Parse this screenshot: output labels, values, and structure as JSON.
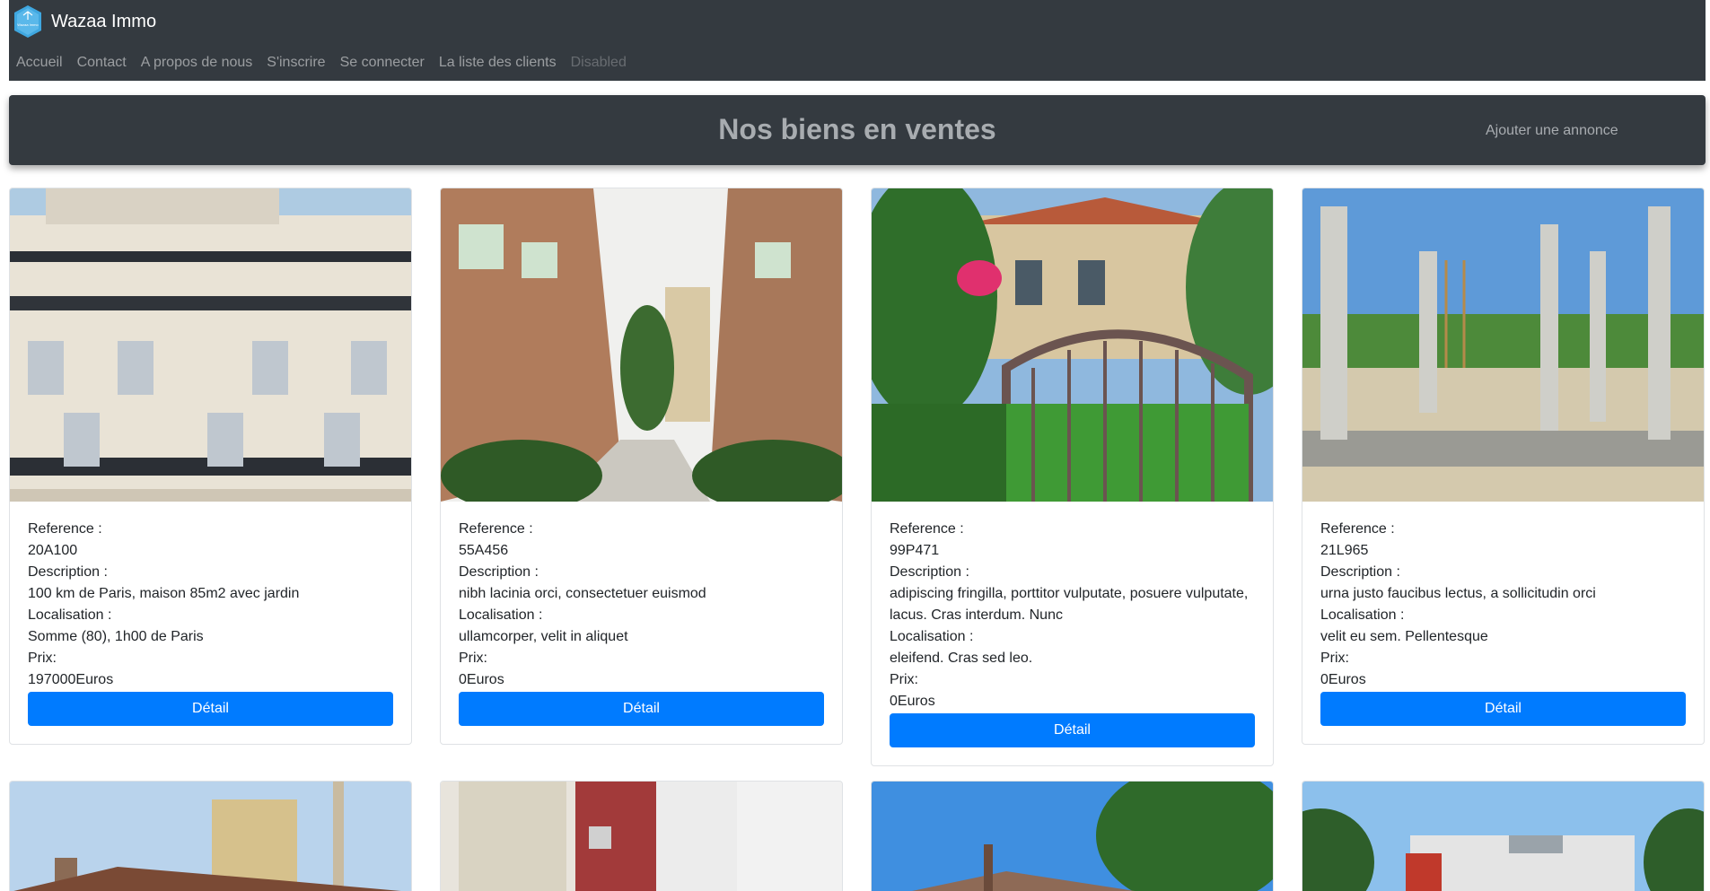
{
  "navbar": {
    "brand": "Wazaa Immo",
    "logo_text": "Wazaa Immo",
    "links": [
      "Accueil",
      "Contact",
      "A propos de nous",
      "S'inscrire",
      "Se connecter",
      "La liste des clients"
    ],
    "disabled_link": "Disabled"
  },
  "banner": {
    "title": "Nos biens en ventes",
    "add_link": "Ajouter une annonce"
  },
  "cards": [
    {
      "ref_label": "Reference :",
      "ref": "20A100",
      "desc_label": "Description :",
      "desc": "100 km de Paris, maison 85m2 avec jardin",
      "loc_label": "Localisation :",
      "loc": "Somme (80), 1h00 de Paris",
      "price_label": "Prix:",
      "price": "197000Euros",
      "button": "Détail"
    },
    {
      "ref_label": "Reference :",
      "ref": "55A456",
      "desc_label": "Description :",
      "desc": "nibh lacinia orci, consectetuer euismod",
      "loc_label": "Localisation :",
      "loc": "ullamcorper, velit in aliquet",
      "price_label": "Prix:",
      "price": "0Euros",
      "button": "Détail"
    },
    {
      "ref_label": "Reference :",
      "ref": "99P471",
      "desc_label": "Description :",
      "desc": "adipiscing fringilla, porttitor vulputate, posuere vulputate, lacus. Cras interdum. Nunc",
      "loc_label": "Localisation :",
      "loc": "eleifend. Cras sed leo.",
      "price_label": "Prix:",
      "price": "0Euros",
      "button": "Détail"
    },
    {
      "ref_label": "Reference :",
      "ref": "21L965",
      "desc_label": "Description :",
      "desc": "urna justo faucibus lectus, a sollicitudin orci",
      "loc_label": "Localisation :",
      "loc": "velit eu sem. Pellentesque",
      "price_label": "Prix:",
      "price": "0Euros",
      "button": "Détail"
    }
  ],
  "colors": {
    "navbar_bg": "#343a40",
    "button_primary": "#007bff",
    "card_border": "#dfe2e5"
  }
}
